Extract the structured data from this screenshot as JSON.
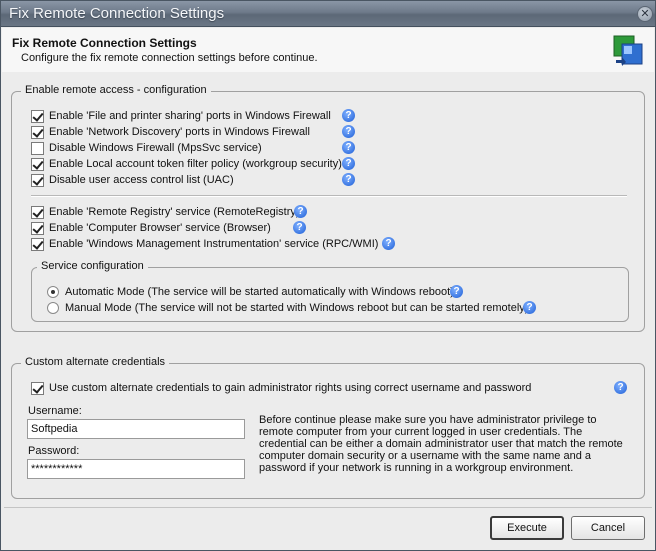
{
  "window": {
    "title": "Fix Remote Connection Settings",
    "close_glyph": "✕"
  },
  "header": {
    "title": "Fix Remote Connection Settings",
    "subtitle": "Configure the fix remote connection settings before continue.",
    "icon": "remote-connection-icon"
  },
  "remote_access": {
    "legend": "Enable remote access - configuration",
    "firewall_items": [
      {
        "label": "Enable 'File and printer sharing' ports in Windows Firewall",
        "checked": true
      },
      {
        "label": "Enable 'Network Discovery' ports in Windows Firewall",
        "checked": true
      },
      {
        "label": "Disable Windows Firewall (MpsSvc service)",
        "checked": false
      },
      {
        "label": "Enable Local account token filter policy (workgroup security)",
        "checked": true
      },
      {
        "label": "Disable user access control list (UAC)",
        "checked": true
      }
    ],
    "service_items": [
      {
        "label": "Enable 'Remote Registry' service (RemoteRegistry)",
        "checked": true
      },
      {
        "label": "Enable 'Computer Browser' service (Browser)",
        "checked": true
      },
      {
        "label": "Enable 'Windows Management Instrumentation' service (RPC/WMI)",
        "checked": true
      }
    ],
    "service_config": {
      "legend": "Service configuration",
      "options": [
        {
          "label": "Automatic Mode (The service will be started automatically with Windows reboot)",
          "selected": true
        },
        {
          "label": "Manual Mode (The service will not be started with Windows reboot but can be started remotely)",
          "selected": false
        }
      ]
    }
  },
  "credentials": {
    "legend": "Custom alternate credentials",
    "use_custom_label": "Use custom alternate credentials to gain administrator rights using correct username and password",
    "use_custom_checked": true,
    "username_label": "Username:",
    "username_value": "Softpedia",
    "password_label": "Password:",
    "password_value": "************",
    "note": "Before continue please make sure you have administrator privilege to remote computer from your current logged in user credentials. The credential can be either a domain administrator user that match the remote computer domain security or a username with the same name and a password if your network is running in a workgroup environment."
  },
  "buttons": {
    "execute": "Execute",
    "cancel": "Cancel"
  },
  "colors": {
    "titlebar": "#6e7a8a",
    "help_icon": "#1f5fd6",
    "window_bg": "#ececec"
  }
}
